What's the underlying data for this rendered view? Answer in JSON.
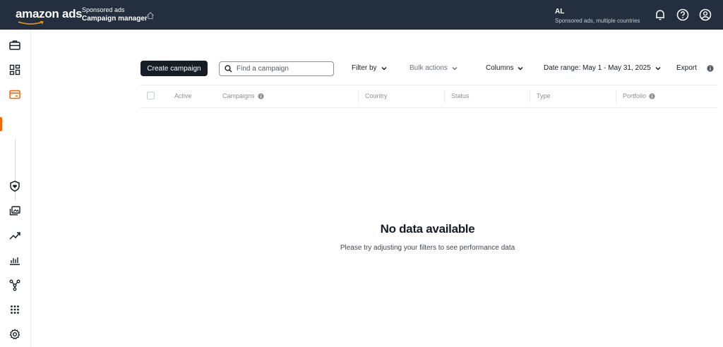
{
  "header": {
    "logo_text": "amazon ads",
    "product_sub": "Sponsored ads",
    "product_main": "Campaign manager",
    "account_code": "AL",
    "account_desc": "Sponsored ads, multiple countries",
    "icons": [
      "home-icon",
      "bell-icon",
      "help-icon",
      "account-icon"
    ]
  },
  "sidebar": {
    "items": [
      {
        "name": "briefcase-icon"
      },
      {
        "name": "dashboard-icon"
      },
      {
        "name": "campaign-manager-icon",
        "active": true
      },
      {
        "name": "brand-shield-icon"
      },
      {
        "name": "creative-assets-icon"
      },
      {
        "name": "trend-icon"
      },
      {
        "name": "reports-icon"
      },
      {
        "name": "connections-icon"
      },
      {
        "name": "apps-grid-icon"
      },
      {
        "name": "settings-icon"
      }
    ],
    "accent_color": "#ff6200"
  },
  "toolbar": {
    "create_label": "Create campaign",
    "search_placeholder": "Find a campaign",
    "filter_label": "Filter by",
    "bulk_label": "Bulk actions",
    "columns_label": "Columns",
    "date_range_label": "Date range: May 1 - May 31, 2025",
    "export_label": "Export"
  },
  "table": {
    "columns": [
      "Active",
      "Campaigns",
      "Country",
      "Status",
      "Type",
      "Portfolio"
    ]
  },
  "empty_state": {
    "title": "No data available",
    "subtitle": "Please try adjusting your filters to see performance data"
  },
  "colors": {
    "topbar": "#232f3e",
    "primary_button": "#161d26"
  }
}
